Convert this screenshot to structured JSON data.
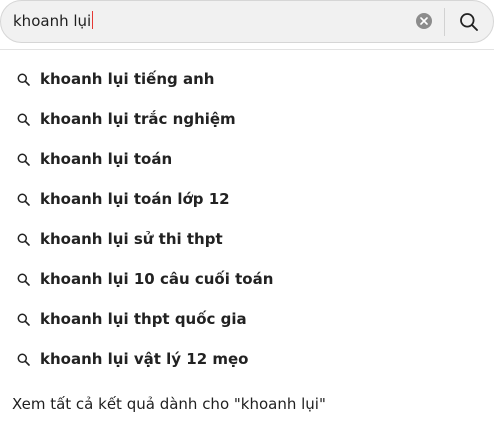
{
  "search": {
    "query": "khoanh lụi"
  },
  "suggestions": [
    "khoanh lụi tiếng anh",
    "khoanh lụi trắc nghiệm",
    "khoanh lụi toán",
    "khoanh lụi toán lớp 12",
    "khoanh lụi sử thi thpt",
    "khoanh lụi 10 câu cuối toán",
    "khoanh lụi thpt quốc gia",
    "khoanh lụi vật lý 12 mẹo"
  ],
  "see_all": {
    "label": "Xem tất cả kết quả dành cho \"khoanh lụi\""
  },
  "icons": {
    "search": "search-icon",
    "clear": "close-icon"
  },
  "colors": {
    "caret": "#e53935",
    "bar_background": "#f1f1f1"
  }
}
